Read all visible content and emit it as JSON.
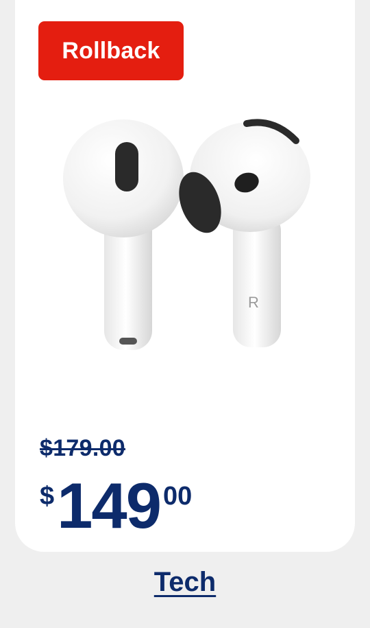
{
  "product": {
    "badge": "Rollback",
    "was_price": "$179.00",
    "price": {
      "currency": "$",
      "whole": "149",
      "cents": "00"
    },
    "image_icon": "earbuds-image"
  },
  "category": {
    "label": "Tech"
  },
  "colors": {
    "badge": "#e41e10",
    "price": "#0d2b6b",
    "background": "#efefef",
    "card": "#ffffff"
  }
}
